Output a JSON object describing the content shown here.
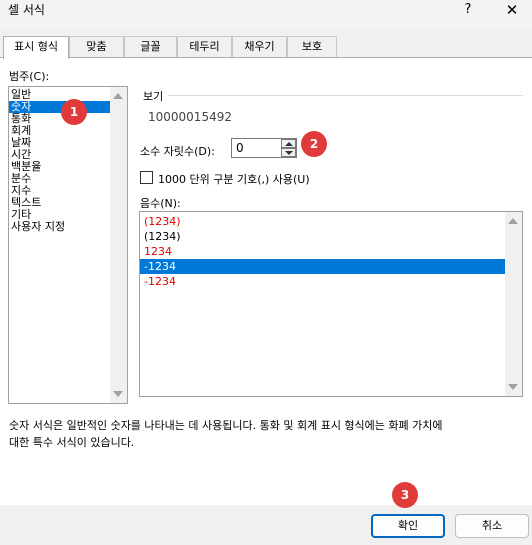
{
  "window": {
    "title": "셀 서식",
    "help": "?",
    "close": "✕"
  },
  "tabs": [
    "표시 형식",
    "맞춤",
    "글꼴",
    "테두리",
    "채우기",
    "보호"
  ],
  "category": {
    "label": "범주(C):",
    "items": [
      "일반",
      "숫자",
      "통화",
      "회계",
      "날짜",
      "시간",
      "백분율",
      "분수",
      "지수",
      "텍스트",
      "기타",
      "사용자 지정"
    ],
    "selected": "숫자"
  },
  "sample": {
    "label": "보기",
    "value": "10000015492"
  },
  "decimal": {
    "label": "소수 자릿수(D):",
    "value": "0"
  },
  "thousands": {
    "label": "1000 단위 구분 기호(,) 사용(U)",
    "checked": false
  },
  "negative": {
    "label": "음수(N):",
    "items": [
      {
        "text": "(1234)",
        "color": "#e00000"
      },
      {
        "text": "(1234)",
        "color": "#000000"
      },
      {
        "text": "1234",
        "color": "#e00000"
      },
      {
        "text": "-1234",
        "color": "#000000"
      },
      {
        "text": "-1234",
        "color": "#e00000"
      }
    ],
    "selected_index": 3
  },
  "description": {
    "line1": "숫자 서식은 일반적인 숫자를 나타내는 데 사용됩니다. 통화 및 회계 표시 형식에는 화폐 가치에",
    "line2": "대한 특수 서식이 있습니다."
  },
  "buttons": {
    "ok": "확인",
    "cancel": "취소"
  },
  "badges": [
    "1",
    "2",
    "3"
  ],
  "colors": {
    "selection": "#0078d7",
    "badge": "#e03a3a",
    "negative_red": "#e00000"
  }
}
